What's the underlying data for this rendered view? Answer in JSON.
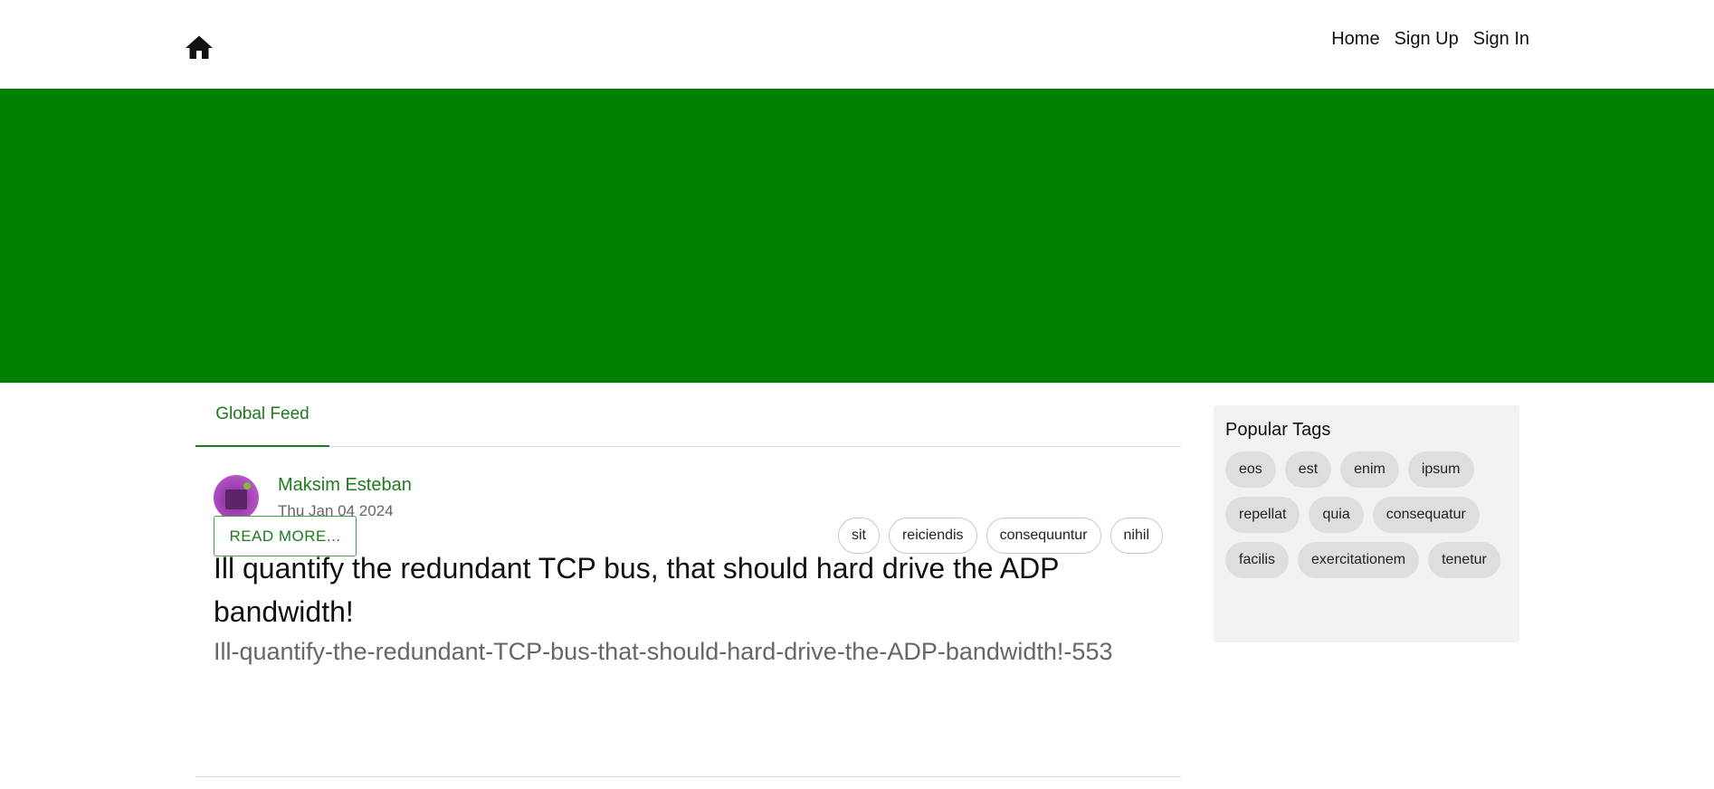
{
  "nav": {
    "links": [
      "Home",
      "Sign Up",
      "Sign In"
    ]
  },
  "banner": {
    "color": "#008000"
  },
  "feed": {
    "tab": "Global Feed",
    "article": {
      "author": "Maksim Esteban",
      "date": "Thu Jan 04 2024",
      "title": "Ill quantify the redundant TCP bus, that should hard drive the ADP bandwidth!",
      "slug": "Ill-quantify-the-redundant-TCP-bus-that-should-hard-drive-the-ADP-bandwidth!-553",
      "read_more": "READ MORE...",
      "tags": [
        "sit",
        "reiciendis",
        "consequuntur",
        "nihil"
      ]
    }
  },
  "sidebar": {
    "title": "Popular Tags",
    "tags": [
      "eos",
      "est",
      "enim",
      "ipsum",
      "repellat",
      "quia",
      "consequatur",
      "facilis",
      "exercitationem",
      "tenetur"
    ]
  },
  "colors": {
    "accent": "#1e7a1e",
    "banner": "#008000",
    "sidebar_bg": "#f2f2f2",
    "tag_bg": "#dedede"
  },
  "icons": {
    "home": "home-icon",
    "avatar": "avatar"
  }
}
